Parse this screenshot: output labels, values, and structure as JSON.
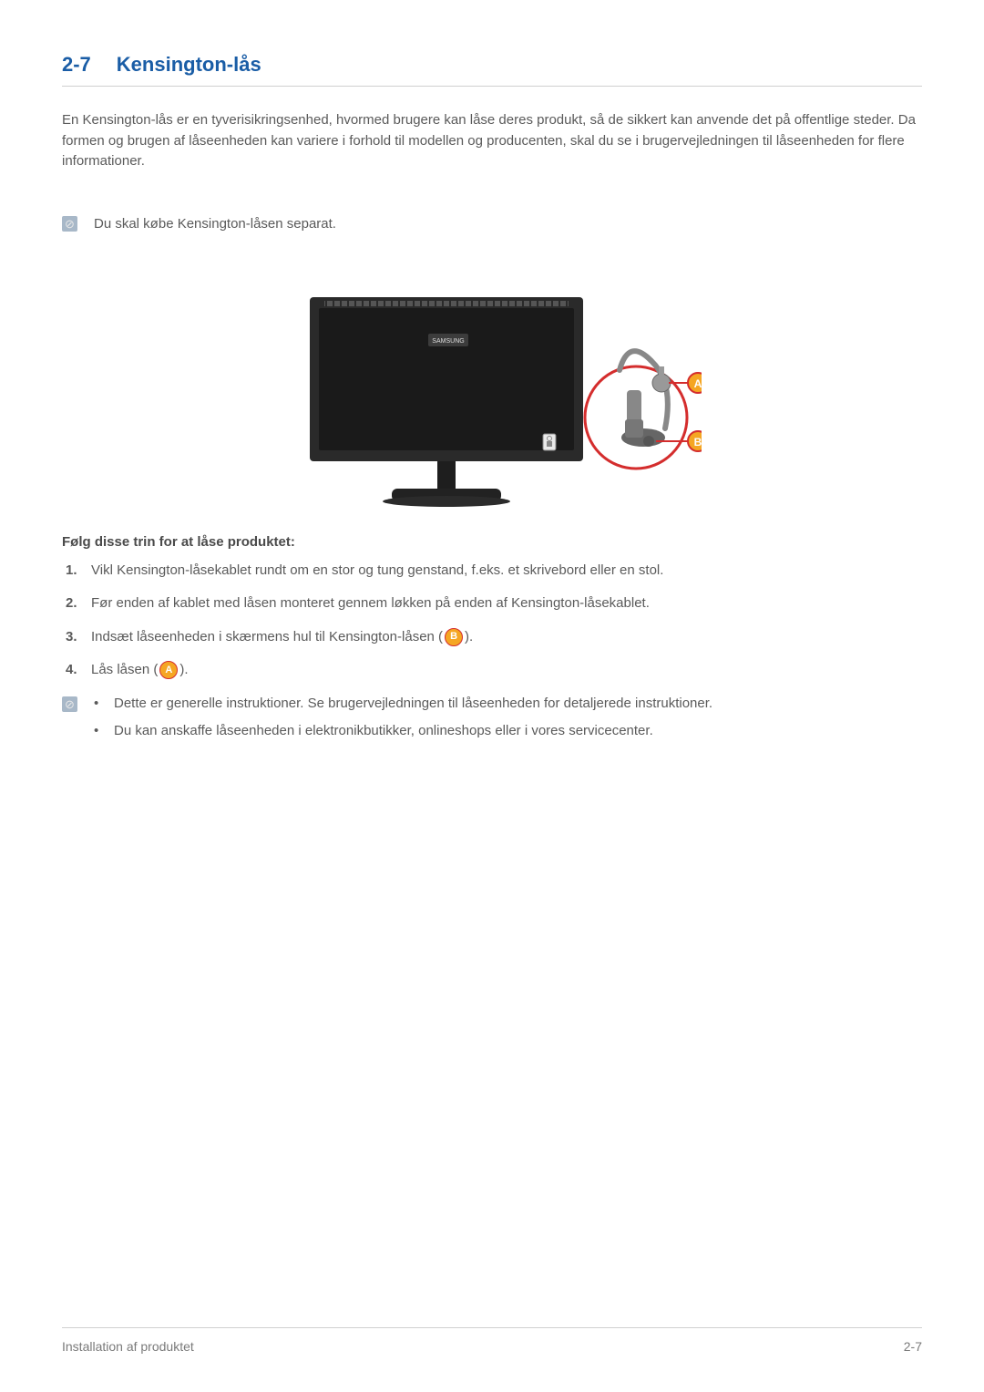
{
  "heading": {
    "number": "2-7",
    "title": "Kensington-lås"
  },
  "intro": "En Kensington-lås er en tyverisikringsenhed, hvormed brugere kan låse deres produkt, så de sikkert kan anvende det på offentlige steder. Da formen og brugen af låseenheden kan variere i forhold til modellen og producenten, skal du se i brugervejledningen til låseenheden for flere informationer.",
  "note1": "Du skal købe Kensington-låsen separat.",
  "figure": {
    "brand": "SAMSUNG",
    "badgeA": "A",
    "badgeB": "B"
  },
  "stepsHeading": "Følg disse trin for at låse produktet:",
  "steps": [
    {
      "n": "1.",
      "text": "Vikl Kensington-låsekablet rundt om en stor og tung genstand, f.eks. et skrivebord eller en stol."
    },
    {
      "n": "2.",
      "text": "Før enden af kablet med låsen monteret gennem løkken på enden af Kensington-låsekablet."
    },
    {
      "n": "3.",
      "pre": "Indsæt låseenheden i skærmens hul til Kensington-låsen (",
      "badge": "B",
      "post": ")."
    },
    {
      "n": "4.",
      "pre": "Lås låsen (",
      "badge": "A",
      "post": ")."
    }
  ],
  "notes2": [
    "Dette er generelle instruktioner. Se brugervejledningen til låseenheden for detaljerede instruktioner.",
    "Du kan anskaffe låseenheden i elektronikbutikker, onlineshops eller i vores servicecenter."
  ],
  "footer": {
    "left": "Installation af produktet",
    "right": "2-7"
  }
}
